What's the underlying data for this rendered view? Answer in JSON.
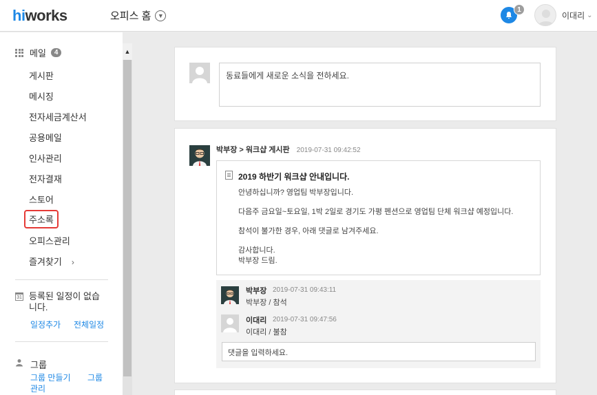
{
  "header": {
    "logo_hi": "hi",
    "logo_rest": "works",
    "office_home": "오피스 홈",
    "notification_count": "1",
    "user_name": "이대리"
  },
  "sidebar": {
    "mail_label": "메일",
    "mail_count": "4",
    "items": [
      {
        "label": "게시판"
      },
      {
        "label": "메시징"
      },
      {
        "label": "전자세금계산서"
      },
      {
        "label": "공용메일"
      },
      {
        "label": "인사관리"
      },
      {
        "label": "전자결재"
      },
      {
        "label": "스토어"
      },
      {
        "label": "주소록"
      },
      {
        "label": "오피스관리"
      },
      {
        "label": "즐겨찾기"
      }
    ],
    "schedule": {
      "empty_text": "등록된 일정이 없습니다.",
      "add_link": "일정추가",
      "all_link": "전체일정"
    },
    "group": {
      "title": "그룹",
      "make_link": "그룹 만들기",
      "manage_link_1": "그룹",
      "manage_link_2": "관리"
    }
  },
  "compose": {
    "placeholder": "동료들에게 새로운 소식을 전하세요."
  },
  "post": {
    "author_board": "박부장 > 워크샵 게시판",
    "time": "2019-07-31 09:42:52",
    "title": "2019 하반기 워크샵 안내입니다.",
    "lines": [
      "안녕하십니까? 영업팀 박부장입니다.",
      "다음주 금요일~토요일, 1박 2일로 경기도 가평 펜션으로 영업팀 단체 워크샵 예정입니다.",
      "참석이 불가한 경우, 아래 댓글로 남겨주세요.",
      "감사합니다.",
      "박부장 드림."
    ]
  },
  "comments": [
    {
      "name": "박부장",
      "time": "2019-07-31 09:43:11",
      "text": "박부장 / 참석"
    },
    {
      "name": "이대리",
      "time": "2019-07-31 09:47:56",
      "text": "이대리 / 불참"
    }
  ],
  "comment_input": {
    "placeholder": "댓글을 입력하세요."
  },
  "colors": {
    "brand_blue": "#1e88e5",
    "highlight_red": "#e53935"
  }
}
